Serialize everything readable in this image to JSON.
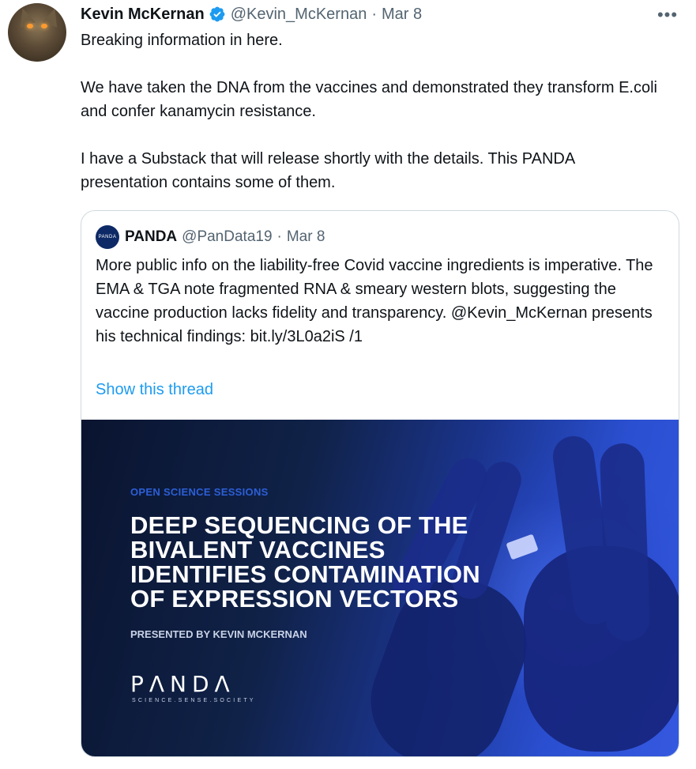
{
  "tweet": {
    "author_name": "Kevin McKernan",
    "author_handle": "@Kevin_McKernan",
    "separator": "·",
    "date": "Mar 8",
    "more_menu": "•••",
    "paragraphs": [
      "Breaking information in here.",
      "We have taken the DNA from the vaccines and demonstrated they transform E.coli and confer kanamycin resistance.",
      "I have a Substack that will release shortly with the details. This PANDA presentation contains some of them."
    ]
  },
  "quote": {
    "avatar_text": "PANDA",
    "author_name": "PANDA",
    "author_handle": "@PanData19",
    "separator": "·",
    "date": "Mar 8",
    "text": "More public info on the liability-free Covid vaccine ingredients is imperative. The EMA & TGA note fragmented RNA & smeary western blots, suggesting the vaccine production lacks fidelity and transparency. @Kevin_McKernan presents his technical findings: bit.ly/3L0a2iS /1",
    "show_thread": "Show this thread"
  },
  "media": {
    "kicker": "OPEN SCIENCE SESSIONS",
    "headline_lines": [
      "DEEP SEQUENCING OF THE",
      "BIVALENT VACCINES",
      "IDENTIFIES CONTAMINATION",
      "OF EXPRESSION VECTORS"
    ],
    "presented_by": "PRESENTED BY KEVIN MCKERNAN",
    "logo": "PΛNDΛ",
    "tagline": "SCIENCE.SENSE.SOCIETY"
  },
  "colors": {
    "link": "#1d9bf0",
    "verified": "#1d9bf0",
    "muted": "#536471",
    "border": "#cfd9de"
  },
  "icons": {
    "verified": "verified-badge-icon",
    "more": "more-options-icon"
  }
}
